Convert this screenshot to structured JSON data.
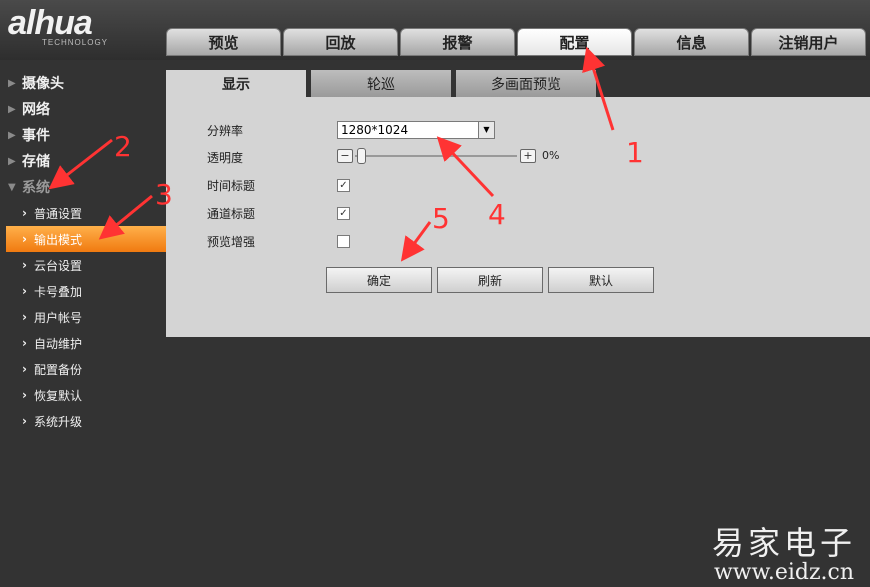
{
  "brand": {
    "name": "alhua",
    "sub": "TECHNOLOGY"
  },
  "main_tabs": [
    "预览",
    "回放",
    "报警",
    "配置",
    "信息",
    "注销用户"
  ],
  "active_main_tab": "配置",
  "sidebar": {
    "categories": [
      "摄像头",
      "网络",
      "事件",
      "存储",
      "系统"
    ],
    "submenu": [
      "普通设置",
      "输出模式",
      "云台设置",
      "卡号叠加",
      "用户帐号",
      "自动维护",
      "配置备份",
      "恢复默认",
      "系统升级"
    ],
    "active_item": "输出模式"
  },
  "sub_tabs": [
    "显示",
    "轮巡",
    "多画面预览"
  ],
  "form": {
    "resolution_label": "分辨率",
    "resolution_value": "1280*1024",
    "transparency_label": "透明度",
    "transparency_value": "0%",
    "time_title_label": "时间标题",
    "time_title_checked": true,
    "channel_title_label": "通道标题",
    "channel_title_checked": true,
    "preview_enhance_label": "预览增强",
    "preview_enhance_checked": false
  },
  "buttons": {
    "ok": "确定",
    "refresh": "刷新",
    "default": "默认"
  },
  "annotations": {
    "n1": "1",
    "n2": "2",
    "n3": "3",
    "n4": "4",
    "n5": "5"
  },
  "watermark": {
    "cn": "易家电子",
    "url": "www.eidz.cn"
  },
  "colors": {
    "annotation": "#ff3333",
    "active_menu": "#f58a18"
  }
}
